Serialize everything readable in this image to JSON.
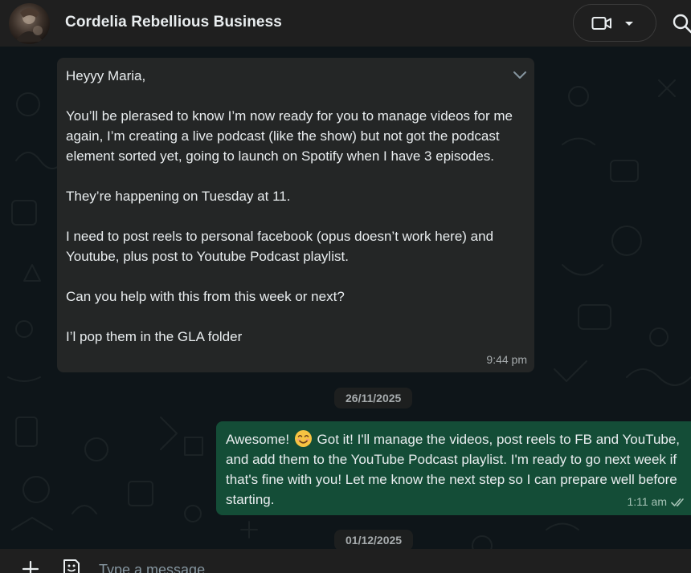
{
  "header": {
    "contact_name": "Cordelia Rebellious Business",
    "icons": [
      "avatar",
      "video-call-icon",
      "chevron-down-icon",
      "search-icon"
    ]
  },
  "messages": [
    {
      "direction": "incoming",
      "paragraphs": [
        "Heyyy Maria,",
        "You’ll be plerased to know I’m now ready for you to manage videos for me again, I’m creating a live podcast (like the show) but not got the podcast element sorted yet, going to launch on Spotify when I have 3 episodes.",
        "They’re happening on Tuesday at 11.",
        "I need to post reels to personal facebook (opus doesn’t work here) and Youtube, plus post to Youtube Podcast playlist.",
        "Can you help with this from this week or next?",
        "I’l pop them in the GLA folder"
      ],
      "time": "9:44 pm"
    },
    {
      "direction": "outgoing",
      "text_before_emoji": "Awesome!",
      "emoji": "smiling-face-icon",
      "text_after_emoji": "Got it! I'll manage the videos, post reels to FB and YouTube, and add them to the YouTube Podcast playlist. I'm ready to go next week if that's fine with you! Let me know the next step so I can prepare well before starting.",
      "time": "1:11 am",
      "status": "read"
    }
  ],
  "dates": [
    "26/11/2025",
    "01/12/2025"
  ],
  "composer": {
    "placeholder": "Type a message"
  },
  "colors": {
    "background": "#0e1519",
    "header": "#1f1f1f",
    "incoming_bubble": "#242626",
    "outgoing_bubble": "#144d37",
    "text": "#e9edef",
    "muted": "#a6abad"
  }
}
